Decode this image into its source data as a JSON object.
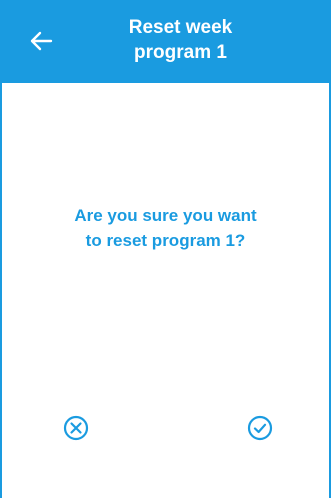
{
  "header": {
    "title_line1": "Reset week",
    "title_line2": "program 1",
    "back_icon": "arrow-left-icon"
  },
  "dialog": {
    "message_line1": "Are you sure you want",
    "message_line2": "to reset program 1?"
  },
  "actions": {
    "cancel_icon": "circle-x-icon",
    "confirm_icon": "circle-check-icon"
  },
  "colors": {
    "primary": "#1a9be0",
    "background": "#ffffff",
    "header_text": "#ffffff"
  }
}
